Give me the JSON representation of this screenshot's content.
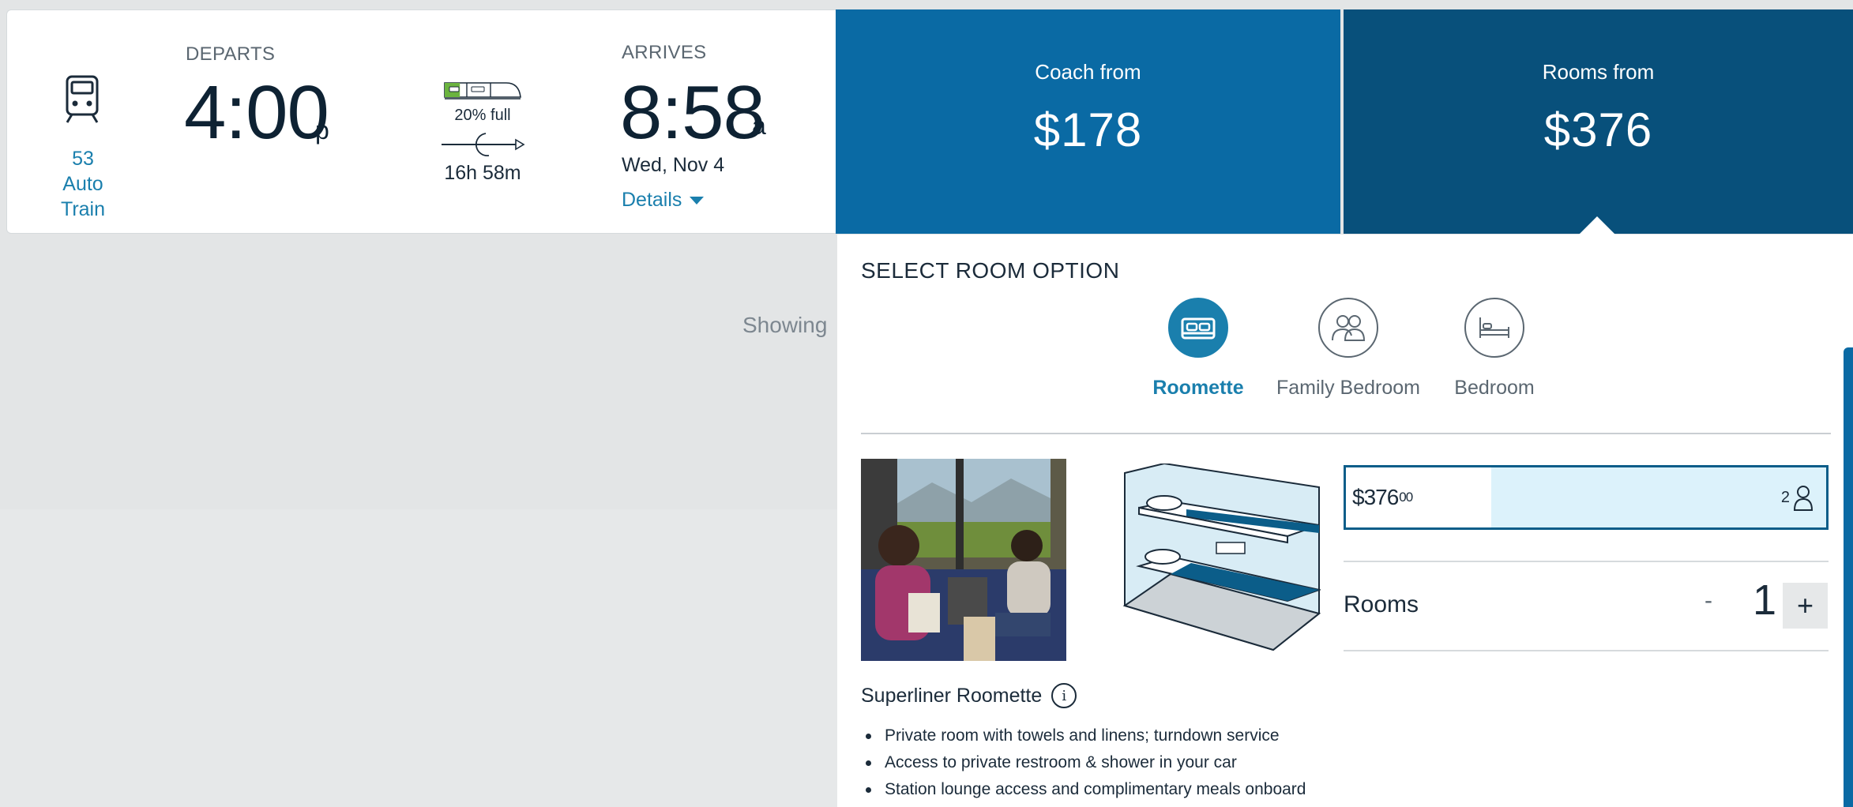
{
  "train": {
    "number": "53",
    "name": "Auto Train",
    "depart_label": "DEPARTS",
    "depart_time": "4:00",
    "depart_suffix": "p",
    "capacity_pct": "20% full",
    "capacity_fill": 0.2,
    "duration": "16h 58m",
    "arrive_label": "ARRIVES",
    "arrive_time": "8:58",
    "arrive_suffix": "a",
    "arrive_date": "Wed, Nov 4",
    "details_label": "Details"
  },
  "fares": {
    "coach_label": "Coach from",
    "coach_price": "$178",
    "rooms_label": "Rooms from",
    "rooms_price": "$376"
  },
  "background_text": "Showing",
  "room_panel": {
    "title": "SELECT ROOM OPTION",
    "options": [
      {
        "label": "Roomette",
        "icon": "roomette-bed-icon",
        "selected": true
      },
      {
        "label": "Family Bedroom",
        "icon": "family-people-icon",
        "selected": false
      },
      {
        "label": "Bedroom",
        "icon": "bed-icon",
        "selected": false
      }
    ],
    "room_name": "Superliner Roomette",
    "features": [
      "Private room with towels and linens; turndown service",
      "Access to private restroom & shower in your car",
      "Station lounge access and complimentary meals onboard"
    ],
    "price_dollars": "$376",
    "price_cents": "00",
    "occupancy": "2",
    "rooms_label": "Rooms",
    "rooms_count": "1",
    "minus_label": "-",
    "plus_label": "+"
  },
  "colors": {
    "accent": "#1a7fad",
    "coach_bg": "#0a6aa4",
    "rooms_bg": "#08507b",
    "selected_price_bg": "#dcf2fb"
  }
}
